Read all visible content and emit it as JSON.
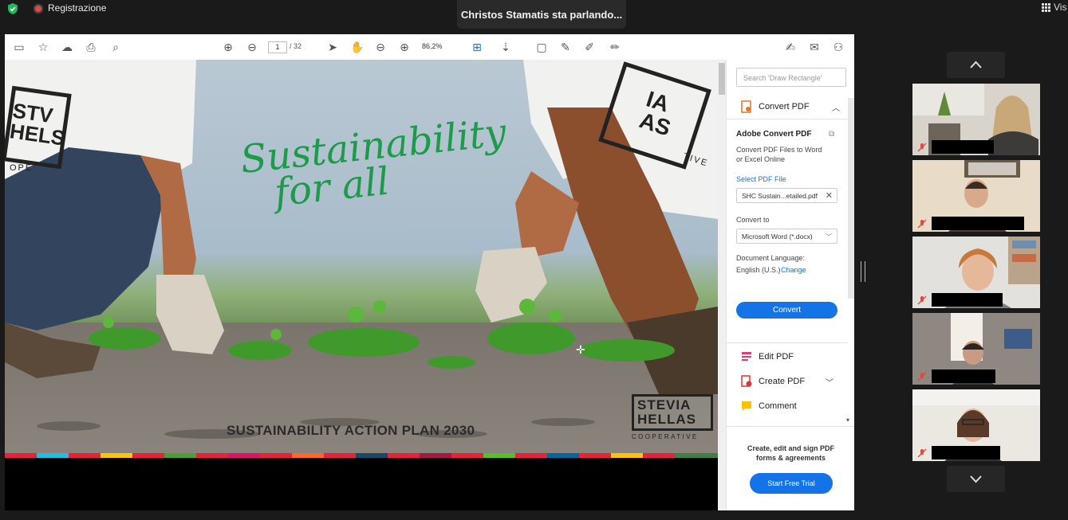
{
  "zoom_bar": {
    "recording_label": "Registrazione",
    "speaker_label": "Christos Stamatis sta parlando...",
    "view_label": "Vis"
  },
  "acrobat": {
    "toolbar": {
      "page_current": "1",
      "page_total": "/ 32",
      "zoom_level": "86,2%"
    },
    "slide": {
      "script_title_line1": "Sustainability",
      "script_title_line2": "for all",
      "shirt_left": "STV\nHELS",
      "shirt_left_bottom": "OPE",
      "shirt_right": "IA\nAS",
      "shirt_right_bottom": "TIVE",
      "plan_title": "SUSTAINABILITY ACTION PLAN 2030",
      "logo_line1": "STEVIA",
      "logo_line2": "HELLAS",
      "logo_sub": "COOPERATIVE"
    },
    "panel": {
      "search_placeholder": "Search 'Draw Rectangle'",
      "convert_pdf_header": "Convert PDF",
      "adobe_title": "Adobe Convert PDF",
      "adobe_desc_line1": "Convert PDF Files to Word",
      "adobe_desc_line2": "or Excel Online",
      "select_pdf_label": "Select PDF File",
      "selected_file": "SHC Sustain...etailed.pdf",
      "convert_to_label": "Convert to",
      "format_value": "Microsoft Word (*.docx)",
      "doc_lang_label": "Document Language:",
      "doc_lang_value": "English (U.S.)",
      "change_link": "Change",
      "convert_button": "Convert",
      "tools": [
        "Edit PDF",
        "Create PDF",
        "Comment"
      ],
      "promo_line1": "Create, edit and sign PDF",
      "promo_line2": "forms & agreements",
      "trial_button": "Start Free Trial"
    }
  },
  "colors": {
    "accent_blue": "#1473e6",
    "script_green": "#1d9a4a",
    "record_red": "#e04a3f"
  }
}
